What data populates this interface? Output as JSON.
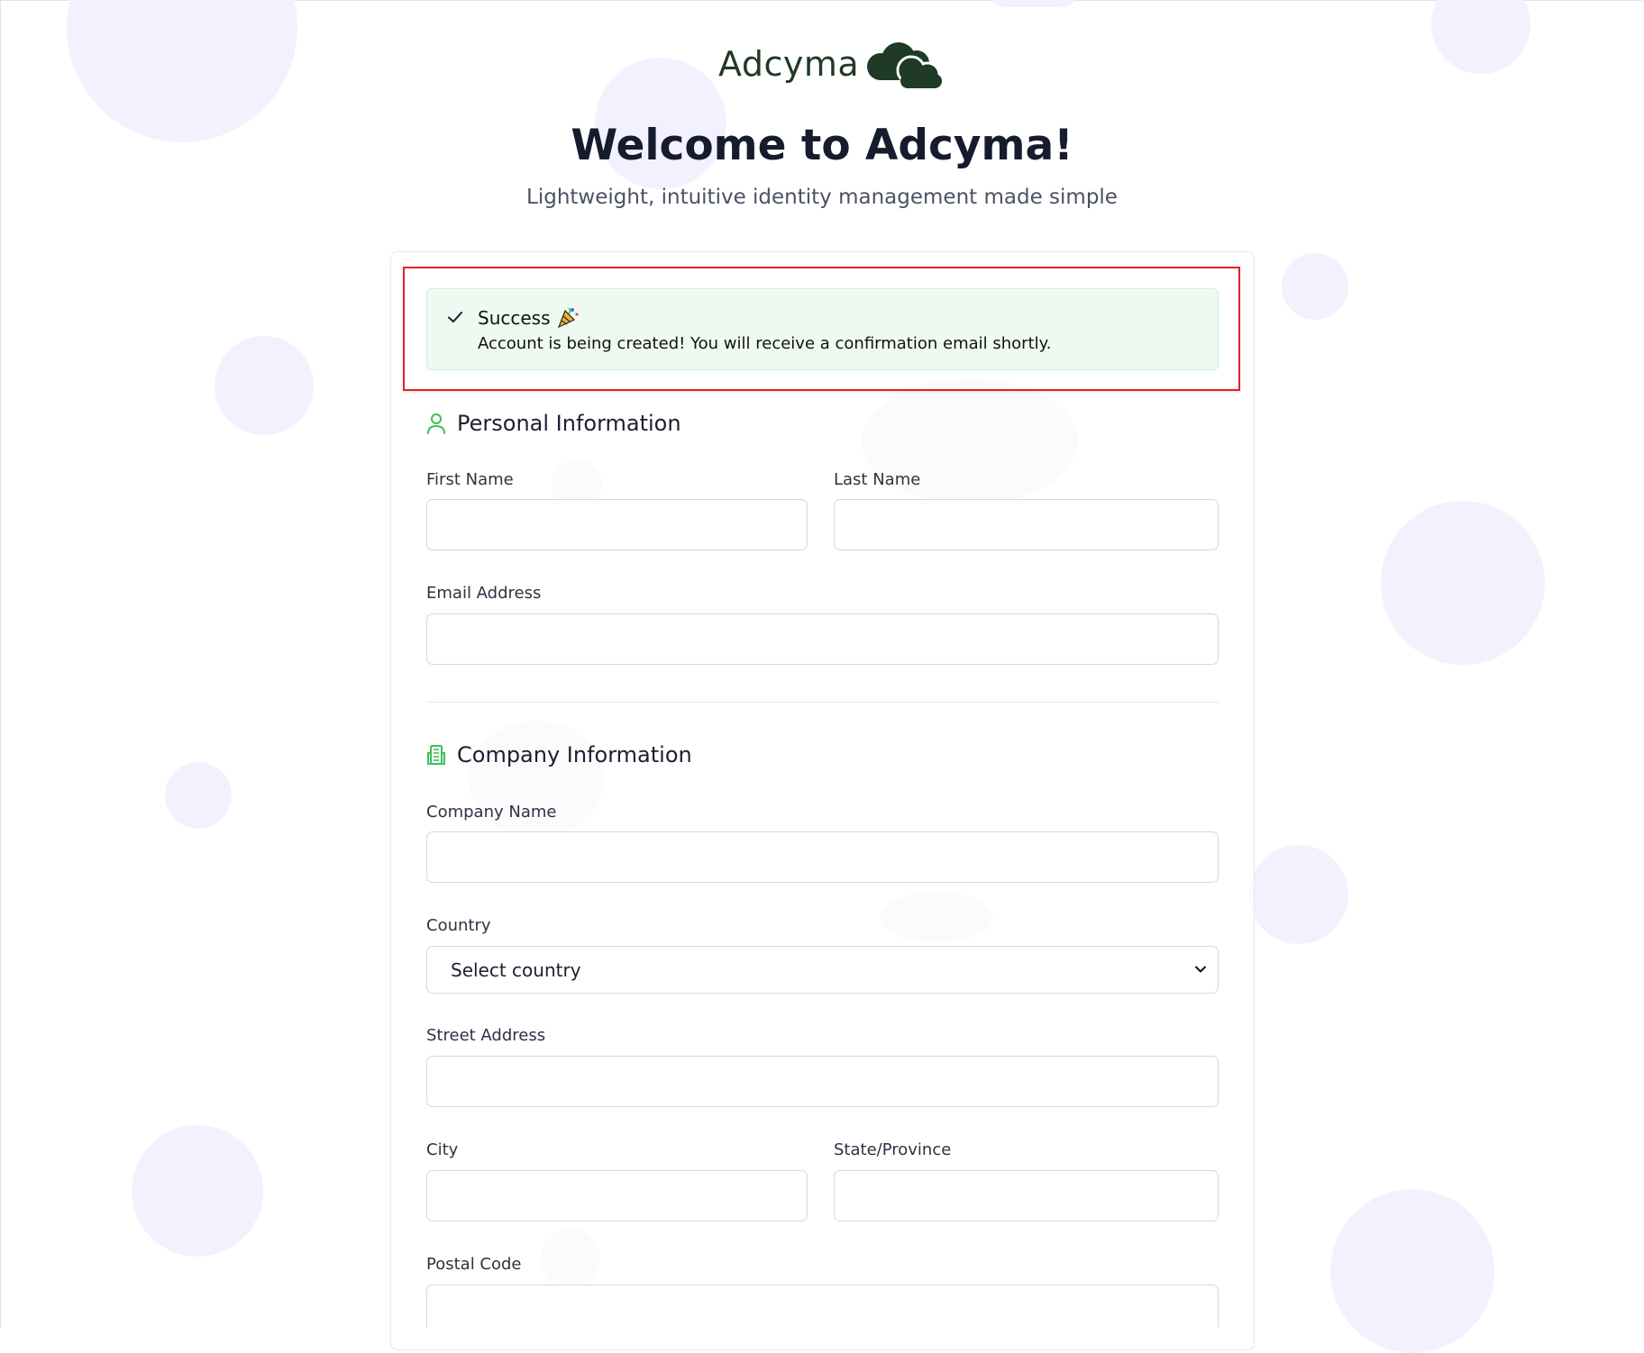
{
  "brand": {
    "name": "Adcyma",
    "color": "#1f3a25",
    "accent": "#3bbf5b"
  },
  "header": {
    "title": "Welcome to Adcyma!",
    "subtitle": "Lightweight, intuitive identity management made simple"
  },
  "alert": {
    "title": "Success",
    "message": "Account is being created! You will receive a confirmation email shortly.",
    "icon": "check-icon",
    "emoji_icon": "party-popper-icon"
  },
  "personal": {
    "heading": "Personal Information",
    "icon": "user-icon",
    "first_name_label": "First Name",
    "first_name_value": "",
    "last_name_label": "Last Name",
    "last_name_value": "",
    "email_label": "Email Address",
    "email_value": ""
  },
  "company": {
    "heading": "Company Information",
    "icon": "building-icon",
    "company_name_label": "Company Name",
    "company_name_value": "",
    "country_label": "Country",
    "country_selected": "Select country",
    "street_label": "Street Address",
    "street_value": "",
    "city_label": "City",
    "city_value": "",
    "state_label": "State/Province",
    "state_value": "",
    "postal_label": "Postal Code",
    "postal_value": ""
  }
}
